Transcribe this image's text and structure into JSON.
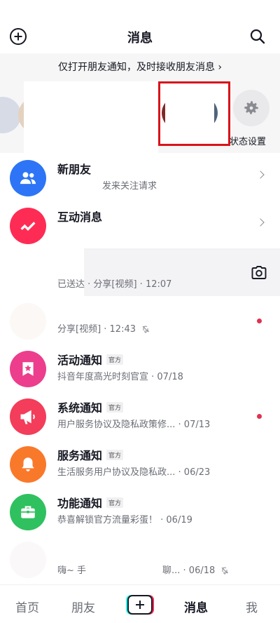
{
  "header": {
    "title": "消息",
    "left_icon": "plus-circle-icon",
    "right_icon": "search-icon"
  },
  "notice": {
    "text": "仅打开朋友通知，及时接收朋友消息 ›"
  },
  "stories": {
    "status_settings_label": "状态设置",
    "status_settings_icon": "gear-icon"
  },
  "items": [
    {
      "name": "新朋友",
      "sub": "发来关注请求",
      "icon": "users-icon",
      "color": "#2d75f6"
    },
    {
      "name": "互动消息",
      "sub": "",
      "icon": "zigzag-icon",
      "color": "#fe2c55"
    },
    {
      "name": "",
      "sub": "已送达 · 分享[视频] · 12:07",
      "icon": "camera-icon"
    },
    {
      "name": "",
      "sub": "分享[视频] · 12:43",
      "icon": "mute-icon"
    },
    {
      "name": "活动通知",
      "badge": "官方",
      "sub": "抖音年度高光时刻官宣 · 07/18",
      "icon": "star-bookmark-icon",
      "color": "#ec3e8c"
    },
    {
      "name": "系统通知",
      "badge": "官方",
      "sub": "用户服务协议及隐私政策修... · 07/13",
      "icon": "megaphone-icon",
      "color": "#f33d5a"
    },
    {
      "name": "服务通知",
      "badge": "官方",
      "sub": "生活服务用户协议及隐私政... · 06/23",
      "icon": "bell-icon",
      "color": "#f9792b"
    },
    {
      "name": "功能通知",
      "badge": "官方",
      "sub": "恭喜解锁官方流量彩蛋！ · 06/19",
      "icon": "briefcase-icon",
      "color": "#2fc15f"
    },
    {
      "name": "",
      "sub_left": "嗨~ 手",
      "sub_right": "聊... · 06/18",
      "icon": "mute-icon"
    }
  ],
  "bottom_nav": {
    "home": "首页",
    "friends": "朋友",
    "add": "+",
    "messages": "消息",
    "me": "我"
  }
}
